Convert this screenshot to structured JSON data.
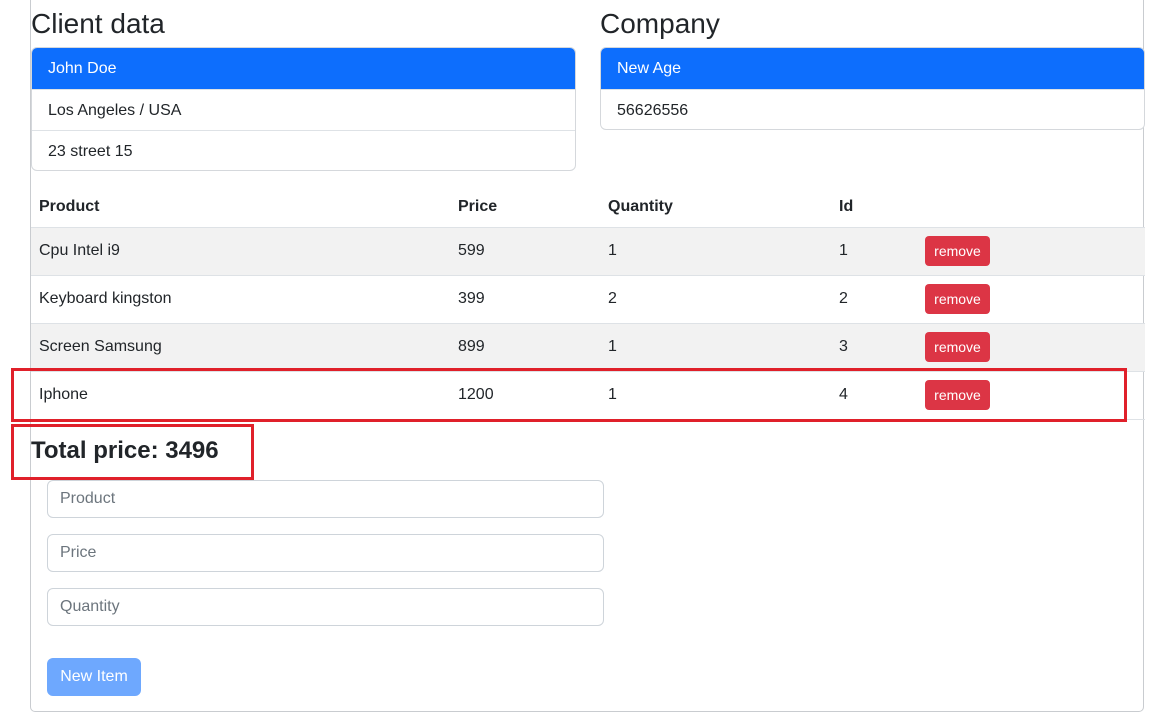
{
  "client": {
    "heading": "Client data",
    "name": "John Doe",
    "location": "Los Angeles / USA",
    "address": "23 street 15"
  },
  "company": {
    "heading": "Company",
    "name": "New Age",
    "number": "56626556"
  },
  "table": {
    "headers": [
      "Product",
      "Price",
      "Quantity",
      "Id",
      ""
    ],
    "rows": [
      {
        "product": "Cpu Intel i9",
        "price": "599",
        "quantity": "1",
        "id": "1",
        "action": "remove"
      },
      {
        "product": "Keyboard kingston",
        "price": "399",
        "quantity": "2",
        "id": "2",
        "action": "remove"
      },
      {
        "product": "Screen Samsung",
        "price": "899",
        "quantity": "1",
        "id": "3",
        "action": "remove"
      },
      {
        "product": "Iphone",
        "price": "1200",
        "quantity": "1",
        "id": "4",
        "action": "remove"
      }
    ]
  },
  "total": "Total price: 3496",
  "form": {
    "product_placeholder": "Product",
    "price_placeholder": "Price",
    "quantity_placeholder": "Quantity",
    "submit_label": "New Item"
  },
  "colors": {
    "primary": "#0d6efd",
    "danger": "#dc3545",
    "highlight": "#e0202a",
    "button_disabled": "#6ea8fe"
  }
}
